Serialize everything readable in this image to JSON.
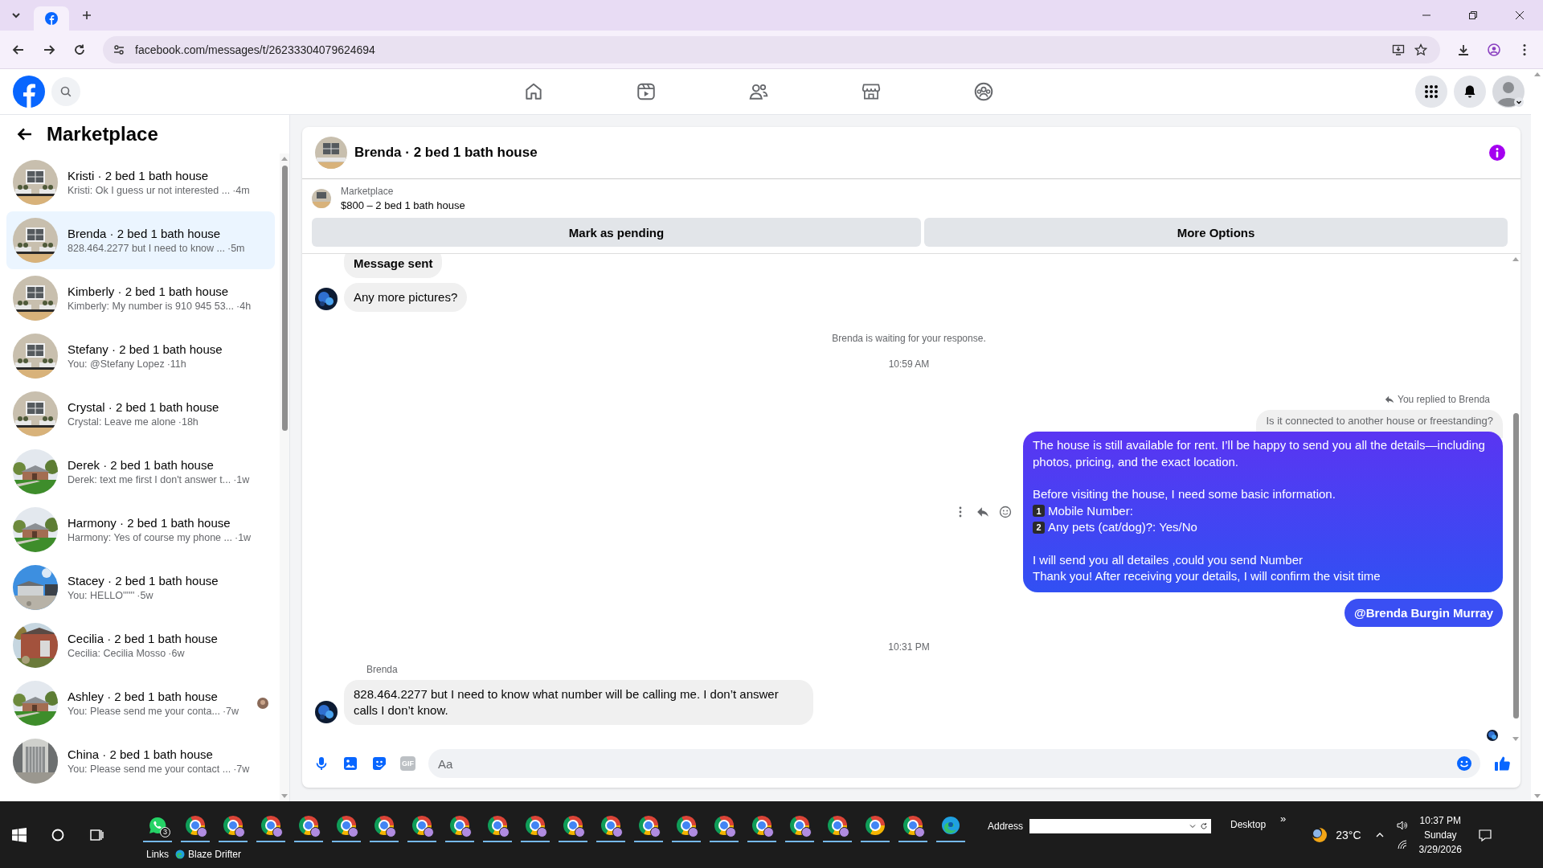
{
  "browser": {
    "url": "facebook.com/messages/t/26233304079624694"
  },
  "sidebar": {
    "title": "Marketplace",
    "items": [
      {
        "name": "Kristi · 2 bed 1 bath house",
        "preview": "Kristi: Ok I guess ur not interested ...",
        "time": "·4m",
        "selected": false,
        "seen": false
      },
      {
        "name": "Brenda · 2 bed 1 bath house",
        "preview": "828.464.2277 but I need to know ...",
        "time": "·5m",
        "selected": true,
        "seen": false
      },
      {
        "name": "Kimberly · 2 bed 1 bath house",
        "preview": "Kimberly: My number is 910 945 53...",
        "time": "·4h",
        "selected": false,
        "seen": false
      },
      {
        "name": "Stefany · 2 bed 1 bath house",
        "preview": "You: @Stefany Lopez",
        "time": "·11h",
        "selected": false,
        "seen": false
      },
      {
        "name": "Crystal · 2 bed 1 bath house",
        "preview": "Crystal: Leave me alone",
        "time": "·18h",
        "selected": false,
        "seen": false
      },
      {
        "name": "Derek · 2 bed 1 bath house",
        "preview": "Derek: text me first I don't answer t...",
        "time": "·1w",
        "selected": false,
        "seen": false
      },
      {
        "name": "Harmony · 2 bed 1 bath house",
        "preview": "Harmony: Yes of course my phone ...",
        "time": "·1w",
        "selected": false,
        "seen": false
      },
      {
        "name": "Stacey · 2 bed 1 bath house",
        "preview": "You: HELLO''''''",
        "time": "·5w",
        "selected": false,
        "seen": false
      },
      {
        "name": "Cecilia · 2 bed 1 bath house",
        "preview": "Cecilia: Cecilia Mosso",
        "time": "·6w",
        "selected": false,
        "seen": false
      },
      {
        "name": "Ashley · 2 bed 1 bath house",
        "preview": "You: Please send me your conta...",
        "time": "·7w",
        "selected": false,
        "seen": true
      },
      {
        "name": "China · 2 bed 1 bath house",
        "preview": "You: Please send me your contact ...",
        "time": "·7w",
        "selected": false,
        "seen": false
      }
    ]
  },
  "chat": {
    "title": "Brenda · 2 bed 1 bath house",
    "listing": {
      "source": "Marketplace",
      "title": "$800 – 2 bed 1 bath house"
    },
    "buttons": [
      "Mark as pending",
      "More Options"
    ],
    "messages": [
      {
        "kind": "incoming",
        "text": "Message sent",
        "avatar": false
      },
      {
        "kind": "incoming",
        "text": "Any more pictures?",
        "avatar": true
      },
      {
        "kind": "notice",
        "text": "Brenda is waiting for your response."
      },
      {
        "kind": "time",
        "text": "10:59 AM"
      },
      {
        "kind": "reply_note",
        "text": "You replied to Brenda"
      },
      {
        "kind": "quote",
        "text": "Is it connected to another house or freestanding?"
      },
      {
        "kind": "outgoing",
        "paragraphs": [
          [
            {
              "text": "The house is still available for rent. I’ll be happy to send you all the details—including photos, pricing, and the exact location."
            }
          ],
          [
            {
              "text": "Before visiting the house, I need some basic information."
            },
            {
              "key": "1",
              "text": " Mobile Number:"
            },
            {
              "key": "2",
              "text": "Any pets (cat/dog)?: Yes/No"
            }
          ],
          [
            {
              "text": "I will send you all detailes ,could you send Number"
            },
            {
              "text": "Thank you! After receiving your details, I will confirm the visit time"
            }
          ]
        ]
      },
      {
        "kind": "mention",
        "text": "@Brenda Burgin Murray"
      },
      {
        "kind": "time",
        "text": "10:31 PM"
      },
      {
        "kind": "sender",
        "text": "Brenda"
      },
      {
        "kind": "incoming",
        "text": "828.464.2277 but I need to know what number will be calling me. I don’t answer calls I don’t know.",
        "avatar": true
      },
      {
        "kind": "seen"
      }
    ],
    "composer": {
      "placeholder": "Aa",
      "gif": "GIF"
    }
  },
  "taskbar": {
    "apps": [
      {
        "kind": "chat",
        "badge": "3"
      },
      {
        "kind": "profile"
      },
      {
        "kind": "profile"
      },
      {
        "kind": "profile"
      },
      {
        "kind": "profile"
      },
      {
        "kind": "profile"
      },
      {
        "kind": "profile"
      },
      {
        "kind": "profile"
      },
      {
        "kind": "profile"
      },
      {
        "kind": "profile"
      },
      {
        "kind": "profile"
      },
      {
        "kind": "profile"
      },
      {
        "kind": "profile"
      },
      {
        "kind": "profile"
      },
      {
        "kind": "profile"
      },
      {
        "kind": "profile"
      },
      {
        "kind": "profile"
      },
      {
        "kind": "profile"
      },
      {
        "kind": "profile"
      },
      {
        "kind": "plain"
      },
      {
        "kind": "profile"
      },
      {
        "kind": "swirl"
      }
    ],
    "address_label": "Address",
    "desktop": "Desktop",
    "more": "»",
    "links": "Links",
    "link": "Blaze Drifter",
    "weather": "23°C",
    "time": "10:37 PM",
    "day": "Sunday",
    "date": "3/29/2026"
  }
}
